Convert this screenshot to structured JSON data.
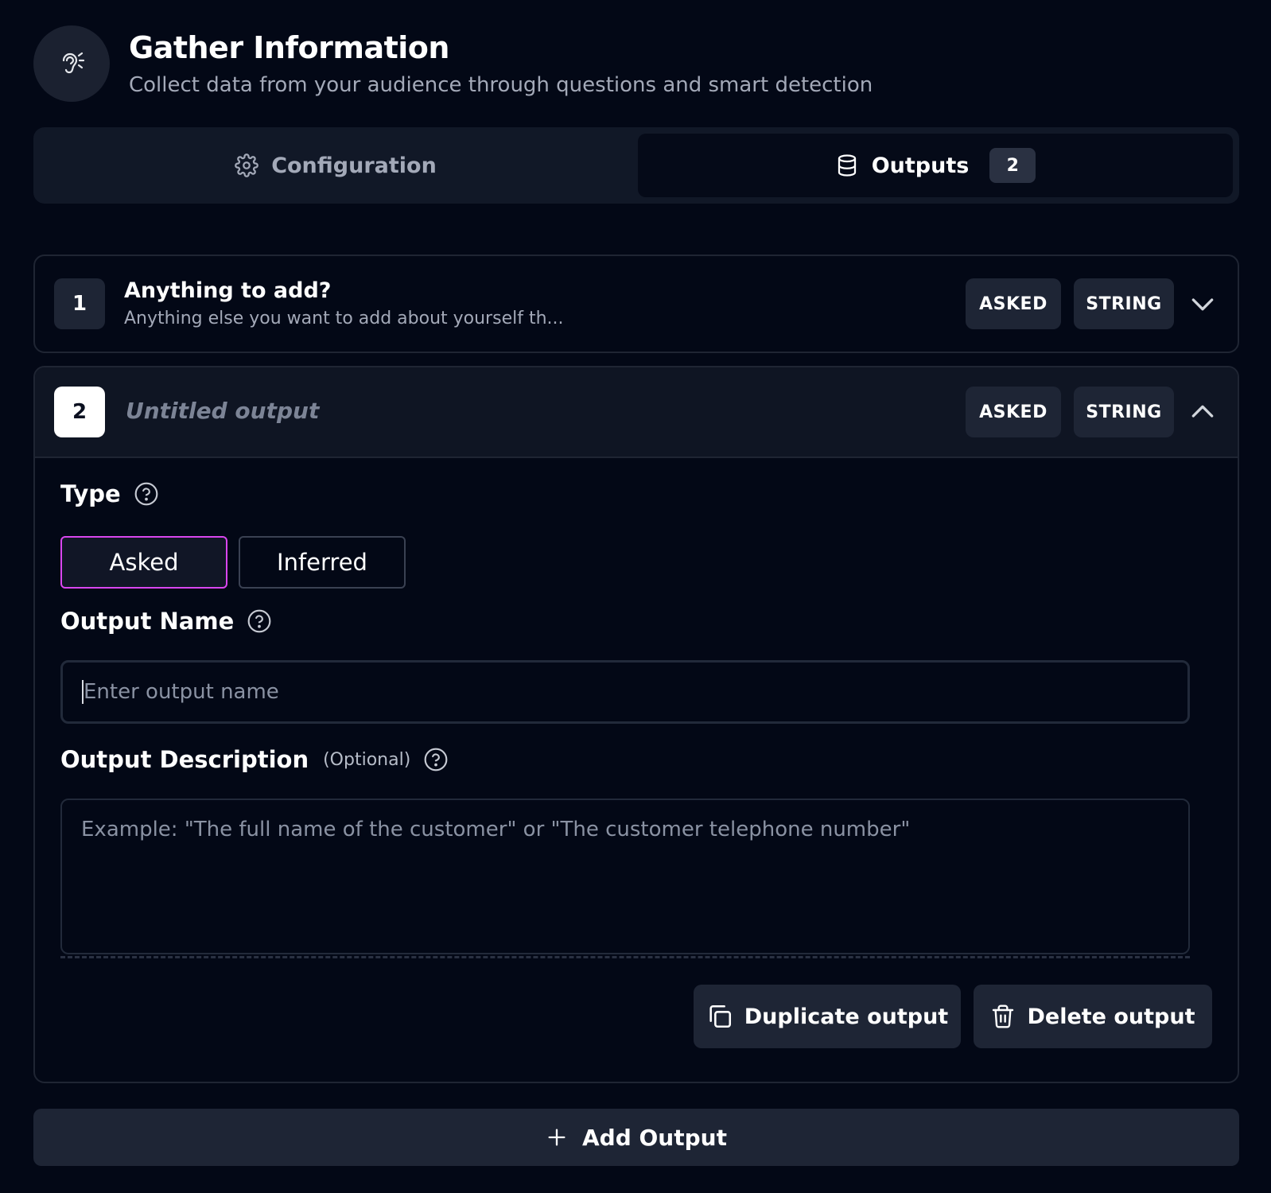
{
  "header": {
    "title": "Gather Information",
    "subtitle": "Collect data from your audience through questions and smart detection",
    "icon": "ear-listening-icon"
  },
  "tabs": [
    {
      "label": "Configuration",
      "icon": "gear-icon",
      "active": false
    },
    {
      "label": "Outputs",
      "icon": "database-icon",
      "count": "2",
      "active": true
    }
  ],
  "outputs": [
    {
      "number": "1",
      "title": "Anything to add?",
      "description": "Anything else you want to add about yourself th...",
      "type_badge": "ASKED",
      "data_badge": "STRING",
      "expanded": false
    },
    {
      "number": "2",
      "title": "Untitled output",
      "type_badge": "ASKED",
      "data_badge": "STRING",
      "expanded": true
    }
  ],
  "form": {
    "type_label": "Type",
    "type_options": [
      "Asked",
      "Inferred"
    ],
    "selected_type": "Asked",
    "name_label": "Output Name",
    "name_placeholder": "Enter output name",
    "name_value": "",
    "description_label": "Output Description",
    "description_optional": "(Optional)",
    "description_placeholder": "Example: \"The full name of the customer\" or \"The customer telephone number\"",
    "duplicate_label": "Duplicate output",
    "delete_label": "Delete output"
  },
  "add_output_label": "Add Output",
  "colors": {
    "background": "#030816",
    "accent_selected": "#d946ef",
    "badge_bg": "#1e2535"
  }
}
